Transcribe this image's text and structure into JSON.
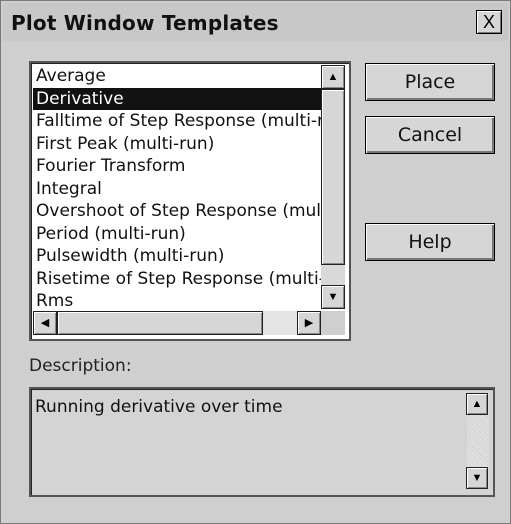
{
  "window": {
    "title": "Plot Window Templates",
    "close_label": "X"
  },
  "templates": {
    "items": [
      "Average",
      "Derivative",
      "Falltime of Step Response (multi-run",
      "First Peak (multi-run)",
      "Fourier Transform",
      "Integral",
      "Overshoot of Step Response (multi",
      "Period (multi-run)",
      "Pulsewidth (multi-run)",
      "Risetime of Step Response (multi-ru",
      "Rms"
    ],
    "selected_item": "Derivative"
  },
  "buttons": {
    "place_label": "Place",
    "cancel_label": "Cancel",
    "help_label": "Help"
  },
  "description": {
    "label": "Description:",
    "text": "Running derivative over time"
  },
  "icons": {
    "up": "scroll-up-arrow-icon",
    "down": "scroll-down-arrow-icon",
    "left": "scroll-left-arrow-icon",
    "right": "scroll-right-arrow-icon"
  }
}
